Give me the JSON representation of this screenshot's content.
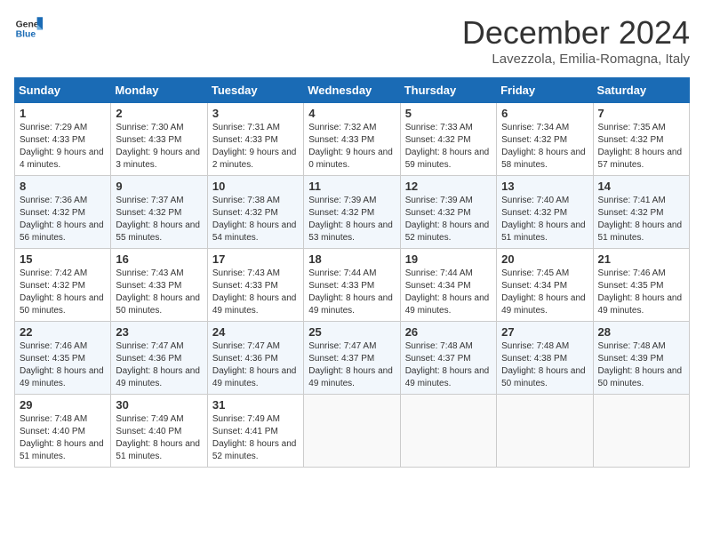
{
  "header": {
    "logo": {
      "general": "General",
      "blue": "Blue"
    },
    "title": "December 2024",
    "location": "Lavezzola, Emilia-Romagna, Italy"
  },
  "calendar": {
    "headers": [
      "Sunday",
      "Monday",
      "Tuesday",
      "Wednesday",
      "Thursday",
      "Friday",
      "Saturday"
    ],
    "weeks": [
      [
        {
          "day": "1",
          "info": "Sunrise: 7:29 AM\nSunset: 4:33 PM\nDaylight: 9 hours and 4 minutes."
        },
        {
          "day": "2",
          "info": "Sunrise: 7:30 AM\nSunset: 4:33 PM\nDaylight: 9 hours and 3 minutes."
        },
        {
          "day": "3",
          "info": "Sunrise: 7:31 AM\nSunset: 4:33 PM\nDaylight: 9 hours and 2 minutes."
        },
        {
          "day": "4",
          "info": "Sunrise: 7:32 AM\nSunset: 4:33 PM\nDaylight: 9 hours and 0 minutes."
        },
        {
          "day": "5",
          "info": "Sunrise: 7:33 AM\nSunset: 4:32 PM\nDaylight: 8 hours and 59 minutes."
        },
        {
          "day": "6",
          "info": "Sunrise: 7:34 AM\nSunset: 4:32 PM\nDaylight: 8 hours and 58 minutes."
        },
        {
          "day": "7",
          "info": "Sunrise: 7:35 AM\nSunset: 4:32 PM\nDaylight: 8 hours and 57 minutes."
        }
      ],
      [
        {
          "day": "8",
          "info": "Sunrise: 7:36 AM\nSunset: 4:32 PM\nDaylight: 8 hours and 56 minutes."
        },
        {
          "day": "9",
          "info": "Sunrise: 7:37 AM\nSunset: 4:32 PM\nDaylight: 8 hours and 55 minutes."
        },
        {
          "day": "10",
          "info": "Sunrise: 7:38 AM\nSunset: 4:32 PM\nDaylight: 8 hours and 54 minutes."
        },
        {
          "day": "11",
          "info": "Sunrise: 7:39 AM\nSunset: 4:32 PM\nDaylight: 8 hours and 53 minutes."
        },
        {
          "day": "12",
          "info": "Sunrise: 7:39 AM\nSunset: 4:32 PM\nDaylight: 8 hours and 52 minutes."
        },
        {
          "day": "13",
          "info": "Sunrise: 7:40 AM\nSunset: 4:32 PM\nDaylight: 8 hours and 51 minutes."
        },
        {
          "day": "14",
          "info": "Sunrise: 7:41 AM\nSunset: 4:32 PM\nDaylight: 8 hours and 51 minutes."
        }
      ],
      [
        {
          "day": "15",
          "info": "Sunrise: 7:42 AM\nSunset: 4:32 PM\nDaylight: 8 hours and 50 minutes."
        },
        {
          "day": "16",
          "info": "Sunrise: 7:43 AM\nSunset: 4:33 PM\nDaylight: 8 hours and 50 minutes."
        },
        {
          "day": "17",
          "info": "Sunrise: 7:43 AM\nSunset: 4:33 PM\nDaylight: 8 hours and 49 minutes."
        },
        {
          "day": "18",
          "info": "Sunrise: 7:44 AM\nSunset: 4:33 PM\nDaylight: 8 hours and 49 minutes."
        },
        {
          "day": "19",
          "info": "Sunrise: 7:44 AM\nSunset: 4:34 PM\nDaylight: 8 hours and 49 minutes."
        },
        {
          "day": "20",
          "info": "Sunrise: 7:45 AM\nSunset: 4:34 PM\nDaylight: 8 hours and 49 minutes."
        },
        {
          "day": "21",
          "info": "Sunrise: 7:46 AM\nSunset: 4:35 PM\nDaylight: 8 hours and 49 minutes."
        }
      ],
      [
        {
          "day": "22",
          "info": "Sunrise: 7:46 AM\nSunset: 4:35 PM\nDaylight: 8 hours and 49 minutes."
        },
        {
          "day": "23",
          "info": "Sunrise: 7:47 AM\nSunset: 4:36 PM\nDaylight: 8 hours and 49 minutes."
        },
        {
          "day": "24",
          "info": "Sunrise: 7:47 AM\nSunset: 4:36 PM\nDaylight: 8 hours and 49 minutes."
        },
        {
          "day": "25",
          "info": "Sunrise: 7:47 AM\nSunset: 4:37 PM\nDaylight: 8 hours and 49 minutes."
        },
        {
          "day": "26",
          "info": "Sunrise: 7:48 AM\nSunset: 4:37 PM\nDaylight: 8 hours and 49 minutes."
        },
        {
          "day": "27",
          "info": "Sunrise: 7:48 AM\nSunset: 4:38 PM\nDaylight: 8 hours and 50 minutes."
        },
        {
          "day": "28",
          "info": "Sunrise: 7:48 AM\nSunset: 4:39 PM\nDaylight: 8 hours and 50 minutes."
        }
      ],
      [
        {
          "day": "29",
          "info": "Sunrise: 7:48 AM\nSunset: 4:40 PM\nDaylight: 8 hours and 51 minutes."
        },
        {
          "day": "30",
          "info": "Sunrise: 7:49 AM\nSunset: 4:40 PM\nDaylight: 8 hours and 51 minutes."
        },
        {
          "day": "31",
          "info": "Sunrise: 7:49 AM\nSunset: 4:41 PM\nDaylight: 8 hours and 52 minutes."
        },
        null,
        null,
        null,
        null
      ]
    ]
  }
}
